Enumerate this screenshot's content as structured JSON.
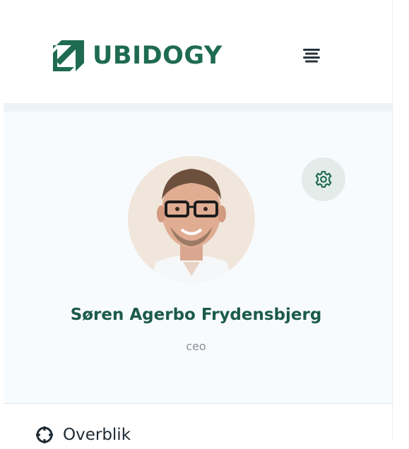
{
  "brand": {
    "name": "UBIDOGY",
    "color": "#1f6b52"
  },
  "header": {
    "menu_icon": "menu-lines-icon"
  },
  "profile": {
    "name": "Søren Agerbo Frydensbjerg",
    "role": "ceo",
    "settings_icon": "gear-icon",
    "avatar_icon": "person-photo"
  },
  "nav": {
    "items": [
      {
        "label": "Overblik",
        "icon": "crosshair-icon"
      }
    ]
  }
}
